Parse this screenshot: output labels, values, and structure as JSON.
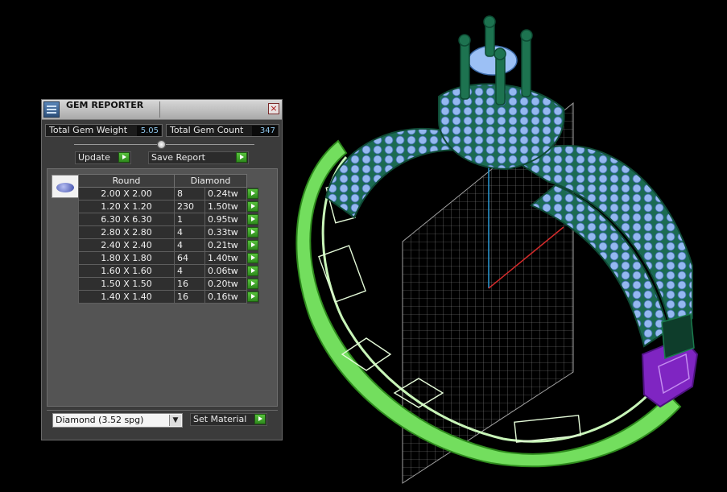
{
  "panel": {
    "title": "GEM REPORTER",
    "close_glyph": "×",
    "stats": {
      "weight_label": "Total Gem Weight",
      "weight_value": "5.05",
      "count_label": "Total Gem Count",
      "count_value": "347"
    },
    "buttons": {
      "update": "Update",
      "save_report": "Save Report",
      "set_material": "Set Material"
    },
    "table": {
      "headers": [
        "Round",
        "Diamond"
      ],
      "rows": [
        {
          "size": "2.00 X 2.00",
          "count": "8",
          "weight": "0.24tw"
        },
        {
          "size": "1.20 X 1.20",
          "count": "230",
          "weight": "1.50tw"
        },
        {
          "size": "6.30 X 6.30",
          "count": "1",
          "weight": "0.95tw"
        },
        {
          "size": "2.80 X 2.80",
          "count": "4",
          "weight": "0.33tw"
        },
        {
          "size": "2.40 X 2.40",
          "count": "4",
          "weight": "0.21tw"
        },
        {
          "size": "1.80 X 1.80",
          "count": "64",
          "weight": "1.40tw"
        },
        {
          "size": "1.60 X 1.60",
          "count": "4",
          "weight": "0.06tw"
        },
        {
          "size": "1.50 X 1.50",
          "count": "16",
          "weight": "0.20tw"
        },
        {
          "size": "1.40 X 1.40",
          "count": "16",
          "weight": "0.16tw"
        }
      ]
    },
    "material_select": {
      "value": "Diamond     (3.52 spg)"
    }
  },
  "colors": {
    "band_green": "#7ee86a",
    "band_dark": "#1f7a4d",
    "gem_blue": "#8fb4ef",
    "clasp_purple": "#8a2bd0",
    "accent_arrow": "#3aa326"
  },
  "icons": [
    "gem-reporter-icon",
    "close-icon",
    "slider-knob",
    "play-arrow-icon",
    "round-gem-icon",
    "dropdown-arrow-icon"
  ]
}
